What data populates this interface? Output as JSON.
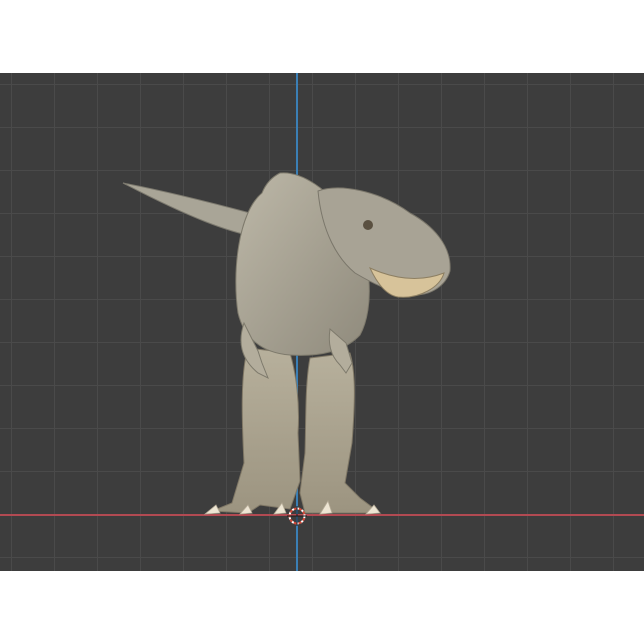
{
  "viewport": {
    "background": "#3d3d3d",
    "grid_color": "#4a4a4a",
    "axis_x_color": "#b24a52",
    "axis_z_color": "#3b7fb5"
  },
  "object": {
    "icon": "dinosaur-model-icon"
  },
  "cursor": {
    "icon": "3d-cursor-icon"
  }
}
